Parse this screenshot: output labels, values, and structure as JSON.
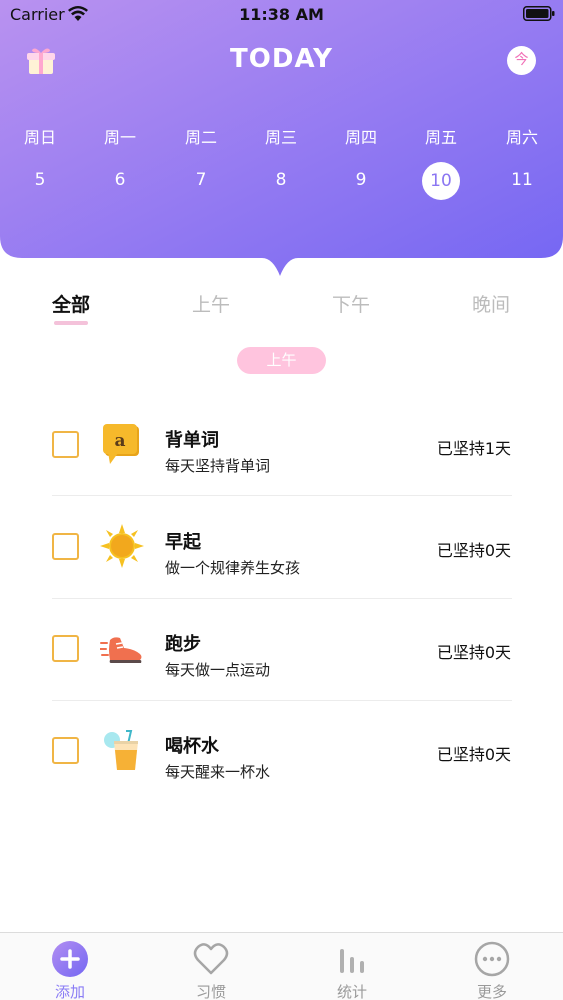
{
  "status_bar": {
    "carrier": "Carrier",
    "time": "11:38 AM"
  },
  "header": {
    "title": "TODAY",
    "today_button": "今"
  },
  "week": {
    "days": [
      {
        "weekday": "周日",
        "day": "5"
      },
      {
        "weekday": "周一",
        "day": "6"
      },
      {
        "weekday": "周二",
        "day": "7"
      },
      {
        "weekday": "周三",
        "day": "8"
      },
      {
        "weekday": "周四",
        "day": "9"
      },
      {
        "weekday": "周五",
        "day": "10"
      },
      {
        "weekday": "周六",
        "day": "11"
      }
    ],
    "selected_day": "10"
  },
  "tabs": [
    "全部",
    "上午",
    "下午",
    "晚间"
  ],
  "active_tab": "全部",
  "section": {
    "label": "上午"
  },
  "habits": [
    {
      "name": "背单词",
      "description": "每天坚持背单词",
      "streak": "已坚持1天",
      "icon": "word-card-icon"
    },
    {
      "name": "早起",
      "description": "做一个规律养生女孩",
      "streak": "已坚持0天",
      "icon": "sun-icon"
    },
    {
      "name": "跑步",
      "description": "每天做一点运动",
      "streak": "已坚持0天",
      "icon": "running-shoe-icon"
    },
    {
      "name": "喝杯水",
      "description": "每天醒来一杯水",
      "streak": "已坚持0天",
      "icon": "drink-cup-icon"
    }
  ],
  "tabbar": [
    {
      "label": "添加",
      "icon": "add-icon"
    },
    {
      "label": "习惯",
      "icon": "heart-icon"
    },
    {
      "label": "统计",
      "icon": "bar-chart-icon"
    },
    {
      "label": "更多",
      "icon": "more-icon"
    }
  ],
  "colors": {
    "header_gradient_start": "#b58ff0",
    "header_gradient_end": "#7566f3",
    "accent": "#8a7cf5",
    "checkbox": "#f0b545",
    "section_pill": "#ffc4de"
  }
}
